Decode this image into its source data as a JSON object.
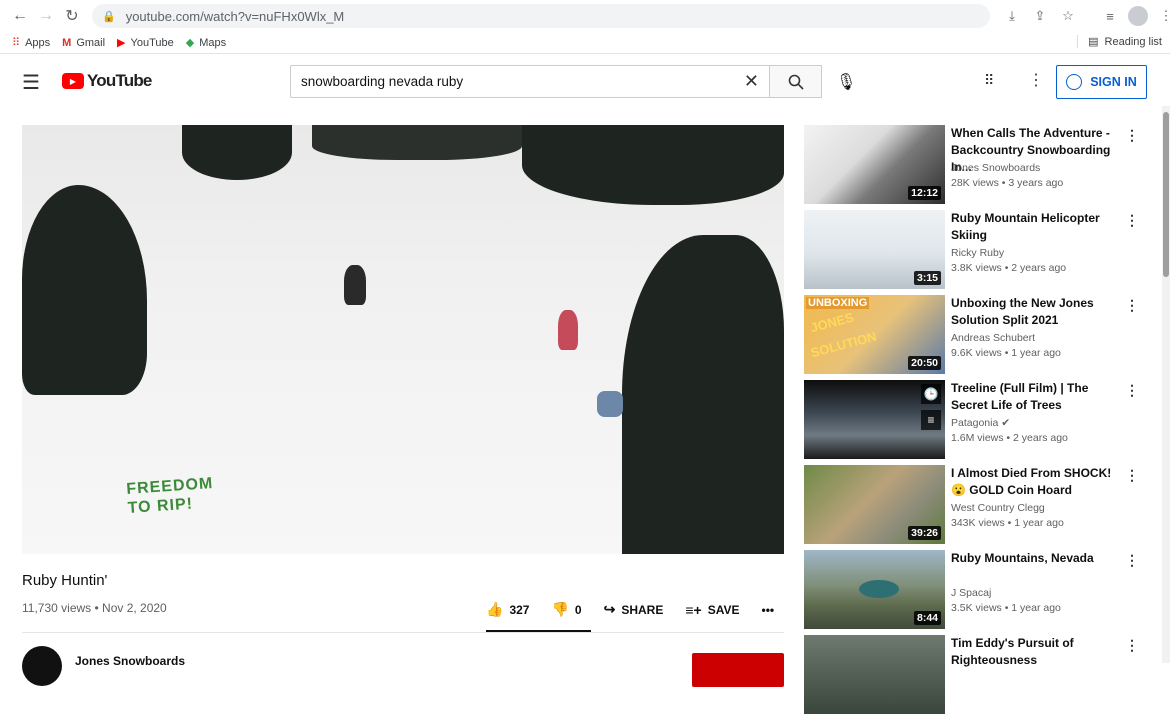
{
  "browser": {
    "url": "youtube.com/watch?v=nuFHx0Wlx_M",
    "bookmarks": [
      {
        "label": "Apps",
        "icon": "apps-grid-icon"
      },
      {
        "label": "Gmail",
        "icon": "gmail-icon"
      },
      {
        "label": "YouTube",
        "icon": "youtube-icon"
      },
      {
        "label": "Maps",
        "icon": "maps-icon"
      }
    ],
    "reading_list": "Reading list"
  },
  "header": {
    "logo_text": "YouTube",
    "search_value": "snowboarding nevada ruby",
    "signin_label": "SIGN IN"
  },
  "video": {
    "overlay_text_line1": "FREEDOM",
    "overlay_text_line2": "TO RIP!",
    "title": "Ruby Huntin'",
    "meta": "11,730 views • Nov 2, 2020",
    "likes": "327",
    "dislikes": "0",
    "share_label": "SHARE",
    "save_label": "SAVE",
    "channel_name": "Jones Snowboards",
    "colors": {
      "accent": "#065fd4",
      "brand": "#ff0000",
      "overlay_green": "#3c8a39"
    }
  },
  "recommendations": [
    {
      "title": "When Calls The Adventure - Backcountry Snowboarding In...",
      "channel": "Jones Snowboards",
      "meta": "28K views • 3 years ago",
      "duration": "12:12"
    },
    {
      "title": "Ruby Mountain Helicopter Skiing",
      "channel": "Ricky Ruby",
      "meta": "3.8K views • 2 years ago",
      "duration": "3:15"
    },
    {
      "title": "Unboxing the New Jones Solution Split 2021",
      "channel": "Andreas Schubert",
      "meta": "9.6K views • 1 year ago",
      "duration": "20:50",
      "thumb_text1": "UNBOXING",
      "thumb_text2": "JONES",
      "thumb_text3": "SOLUTION"
    },
    {
      "title": "Treeline (Full Film) | The Secret Life of Trees",
      "channel": "Patagonia ✔",
      "meta": "1.6M views • 2 years ago",
      "duration": ""
    },
    {
      "title": "I Almost Died From SHOCK! 😮 GOLD Coin Hoard",
      "channel": "West Country Clegg",
      "meta": "343K views • 1 year ago",
      "duration": "39:26"
    },
    {
      "title": "Ruby Mountains, Nevada",
      "channel": "J Spacaj",
      "meta": "3.5K views • 1 year ago",
      "duration": "8:44"
    },
    {
      "title": "Tim Eddy's Pursuit of Righteousness",
      "channel": "",
      "meta": "",
      "duration": ""
    }
  ]
}
